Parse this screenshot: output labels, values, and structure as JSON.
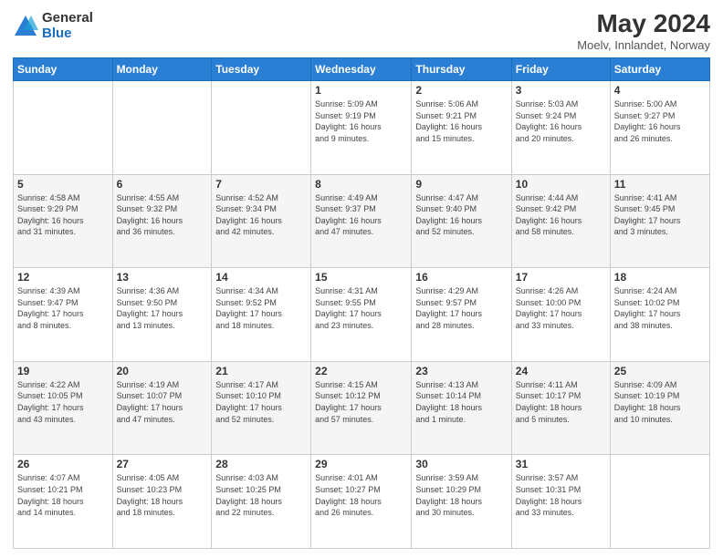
{
  "header": {
    "logo_general": "General",
    "logo_blue": "Blue",
    "title": "May 2024",
    "subtitle": "Moelv, Innlandet, Norway"
  },
  "days_of_week": [
    "Sunday",
    "Monday",
    "Tuesday",
    "Wednesday",
    "Thursday",
    "Friday",
    "Saturday"
  ],
  "weeks": [
    [
      {
        "day": "",
        "info": ""
      },
      {
        "day": "",
        "info": ""
      },
      {
        "day": "",
        "info": ""
      },
      {
        "day": "1",
        "info": "Sunrise: 5:09 AM\nSunset: 9:19 PM\nDaylight: 16 hours\nand 9 minutes."
      },
      {
        "day": "2",
        "info": "Sunrise: 5:06 AM\nSunset: 9:21 PM\nDaylight: 16 hours\nand 15 minutes."
      },
      {
        "day": "3",
        "info": "Sunrise: 5:03 AM\nSunset: 9:24 PM\nDaylight: 16 hours\nand 20 minutes."
      },
      {
        "day": "4",
        "info": "Sunrise: 5:00 AM\nSunset: 9:27 PM\nDaylight: 16 hours\nand 26 minutes."
      }
    ],
    [
      {
        "day": "5",
        "info": "Sunrise: 4:58 AM\nSunset: 9:29 PM\nDaylight: 16 hours\nand 31 minutes."
      },
      {
        "day": "6",
        "info": "Sunrise: 4:55 AM\nSunset: 9:32 PM\nDaylight: 16 hours\nand 36 minutes."
      },
      {
        "day": "7",
        "info": "Sunrise: 4:52 AM\nSunset: 9:34 PM\nDaylight: 16 hours\nand 42 minutes."
      },
      {
        "day": "8",
        "info": "Sunrise: 4:49 AM\nSunset: 9:37 PM\nDaylight: 16 hours\nand 47 minutes."
      },
      {
        "day": "9",
        "info": "Sunrise: 4:47 AM\nSunset: 9:40 PM\nDaylight: 16 hours\nand 52 minutes."
      },
      {
        "day": "10",
        "info": "Sunrise: 4:44 AM\nSunset: 9:42 PM\nDaylight: 16 hours\nand 58 minutes."
      },
      {
        "day": "11",
        "info": "Sunrise: 4:41 AM\nSunset: 9:45 PM\nDaylight: 17 hours\nand 3 minutes."
      }
    ],
    [
      {
        "day": "12",
        "info": "Sunrise: 4:39 AM\nSunset: 9:47 PM\nDaylight: 17 hours\nand 8 minutes."
      },
      {
        "day": "13",
        "info": "Sunrise: 4:36 AM\nSunset: 9:50 PM\nDaylight: 17 hours\nand 13 minutes."
      },
      {
        "day": "14",
        "info": "Sunrise: 4:34 AM\nSunset: 9:52 PM\nDaylight: 17 hours\nand 18 minutes."
      },
      {
        "day": "15",
        "info": "Sunrise: 4:31 AM\nSunset: 9:55 PM\nDaylight: 17 hours\nand 23 minutes."
      },
      {
        "day": "16",
        "info": "Sunrise: 4:29 AM\nSunset: 9:57 PM\nDaylight: 17 hours\nand 28 minutes."
      },
      {
        "day": "17",
        "info": "Sunrise: 4:26 AM\nSunset: 10:00 PM\nDaylight: 17 hours\nand 33 minutes."
      },
      {
        "day": "18",
        "info": "Sunrise: 4:24 AM\nSunset: 10:02 PM\nDaylight: 17 hours\nand 38 minutes."
      }
    ],
    [
      {
        "day": "19",
        "info": "Sunrise: 4:22 AM\nSunset: 10:05 PM\nDaylight: 17 hours\nand 43 minutes."
      },
      {
        "day": "20",
        "info": "Sunrise: 4:19 AM\nSunset: 10:07 PM\nDaylight: 17 hours\nand 47 minutes."
      },
      {
        "day": "21",
        "info": "Sunrise: 4:17 AM\nSunset: 10:10 PM\nDaylight: 17 hours\nand 52 minutes."
      },
      {
        "day": "22",
        "info": "Sunrise: 4:15 AM\nSunset: 10:12 PM\nDaylight: 17 hours\nand 57 minutes."
      },
      {
        "day": "23",
        "info": "Sunrise: 4:13 AM\nSunset: 10:14 PM\nDaylight: 18 hours\nand 1 minute."
      },
      {
        "day": "24",
        "info": "Sunrise: 4:11 AM\nSunset: 10:17 PM\nDaylight: 18 hours\nand 5 minutes."
      },
      {
        "day": "25",
        "info": "Sunrise: 4:09 AM\nSunset: 10:19 PM\nDaylight: 18 hours\nand 10 minutes."
      }
    ],
    [
      {
        "day": "26",
        "info": "Sunrise: 4:07 AM\nSunset: 10:21 PM\nDaylight: 18 hours\nand 14 minutes."
      },
      {
        "day": "27",
        "info": "Sunrise: 4:05 AM\nSunset: 10:23 PM\nDaylight: 18 hours\nand 18 minutes."
      },
      {
        "day": "28",
        "info": "Sunrise: 4:03 AM\nSunset: 10:25 PM\nDaylight: 18 hours\nand 22 minutes."
      },
      {
        "day": "29",
        "info": "Sunrise: 4:01 AM\nSunset: 10:27 PM\nDaylight: 18 hours\nand 26 minutes."
      },
      {
        "day": "30",
        "info": "Sunrise: 3:59 AM\nSunset: 10:29 PM\nDaylight: 18 hours\nand 30 minutes."
      },
      {
        "day": "31",
        "info": "Sunrise: 3:57 AM\nSunset: 10:31 PM\nDaylight: 18 hours\nand 33 minutes."
      },
      {
        "day": "",
        "info": ""
      }
    ]
  ]
}
